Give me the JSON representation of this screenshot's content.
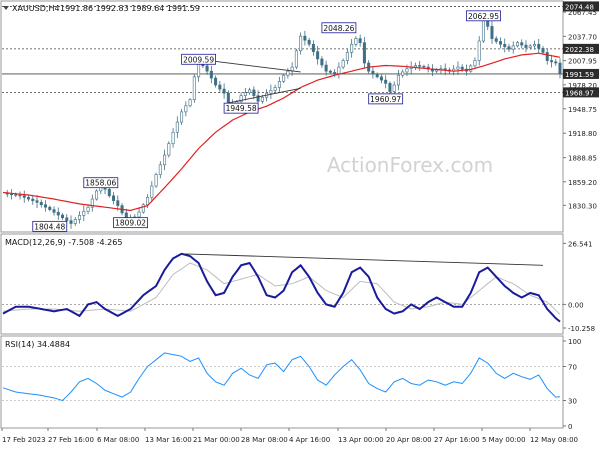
{
  "header": {
    "symbol": "XAUUSD,H4",
    "ohlc": "1991.86 1992.83 1989.64 1991.59"
  },
  "watermark": "ActionForex.com",
  "colors": {
    "candle": "#3f6f85",
    "ma": "#e02020",
    "macd": "#1a1a9c",
    "signal": "#bdbdbd",
    "rsi": "#1e90ff",
    "trendline": "#333333",
    "label_border": "#1a1a9c",
    "price_tag_bg": "#2b2b2b",
    "price_tag_fg": "#ffffff"
  },
  "chart_data": [
    {
      "type": "candlestick",
      "panel": "price",
      "ylim": [
        1800,
        2075
      ],
      "y_ticks": [
        "2067.45",
        "2037.70",
        "2007.95",
        "1978.20",
        "1948.75",
        "1918.80",
        "1888.85",
        "1859.20",
        "1830.30"
      ],
      "x_ticks": [
        "17 Feb 2023",
        "27 Feb 16:00",
        "6 Mar 08:00",
        "13 Mar 16:00",
        "21 Mar 00:00",
        "28 Mar 08:00",
        "4 Apr 16:00",
        "13 Apr 00:00",
        "20 Apr 08:00",
        "27 Apr 16:00",
        "5 May 00:00",
        "12 May 08:00"
      ],
      "close_path": [
        [
          0,
          1845
        ],
        [
          4,
          1842
        ],
        [
          8,
          1834
        ],
        [
          11,
          1825
        ],
        [
          14,
          1815
        ],
        [
          16,
          1808
        ],
        [
          18,
          1818
        ],
        [
          20,
          1828
        ],
        [
          22,
          1848
        ],
        [
          23,
          1858
        ],
        [
          25,
          1842
        ],
        [
          27,
          1830
        ],
        [
          29,
          1812
        ],
        [
          30,
          1810
        ],
        [
          32,
          1822
        ],
        [
          34,
          1840
        ],
        [
          36,
          1868
        ],
        [
          38,
          1892
        ],
        [
          40,
          1920
        ],
        [
          42,
          1945
        ],
        [
          44,
          1960
        ],
        [
          45,
          1988
        ],
        [
          46,
          2008
        ],
        [
          48,
          1995
        ],
        [
          50,
          1978
        ],
        [
          52,
          1968
        ],
        [
          53,
          1955
        ],
        [
          54,
          1950
        ],
        [
          56,
          1965
        ],
        [
          58,
          1972
        ],
        [
          60,
          1958
        ],
        [
          62,
          1968
        ],
        [
          64,
          1975
        ],
        [
          66,
          1990
        ],
        [
          68,
          2000
        ],
        [
          69,
          2020
        ],
        [
          70,
          2038
        ],
        [
          72,
          2028
        ],
        [
          74,
          2010
        ],
        [
          76,
          1995
        ],
        [
          78,
          1992
        ],
        [
          80,
          2008
        ],
        [
          82,
          2028
        ],
        [
          83,
          2035
        ],
        [
          84,
          2030
        ],
        [
          85,
          2005
        ],
        [
          86,
          1995
        ],
        [
          88,
          1988
        ],
        [
          90,
          1980
        ],
        [
          91,
          1970
        ],
        [
          92,
          1978
        ],
        [
          93,
          1990
        ],
        [
          95,
          1998
        ],
        [
          97,
          2002
        ],
        [
          99,
          2000
        ],
        [
          101,
          1995
        ],
        [
          103,
          1998
        ],
        [
          105,
          1995
        ],
        [
          107,
          2000
        ],
        [
          109,
          1995
        ],
        [
          111,
          2008
        ],
        [
          112,
          2032
        ],
        [
          113,
          2060
        ],
        [
          114,
          2050
        ],
        [
          115,
          2035
        ],
        [
          117,
          2028
        ],
        [
          119,
          2022
        ],
        [
          121,
          2030
        ],
        [
          123,
          2024
        ],
        [
          125,
          2028
        ],
        [
          127,
          2018
        ],
        [
          128,
          2008
        ],
        [
          130,
          2005
        ],
        [
          131,
          1991.59
        ]
      ],
      "ma_path": [
        [
          0,
          1846
        ],
        [
          6,
          1843
        ],
        [
          12,
          1838
        ],
        [
          18,
          1832
        ],
        [
          24,
          1828
        ],
        [
          30,
          1824
        ],
        [
          34,
          1830
        ],
        [
          38,
          1852
        ],
        [
          42,
          1875
        ],
        [
          46,
          1900
        ],
        [
          50,
          1920
        ],
        [
          54,
          1935
        ],
        [
          58,
          1945
        ],
        [
          62,
          1952
        ],
        [
          66,
          1962
        ],
        [
          70,
          1975
        ],
        [
          74,
          1984
        ],
        [
          78,
          1990
        ],
        [
          82,
          1995
        ],
        [
          86,
          2000
        ],
        [
          90,
          2002
        ],
        [
          94,
          2001
        ],
        [
          98,
          1999
        ],
        [
          102,
          1997
        ],
        [
          106,
          1995
        ],
        [
          110,
          1997
        ],
        [
          114,
          2003
        ],
        [
          118,
          2010
        ],
        [
          122,
          2015
        ],
        [
          126,
          2017
        ],
        [
          128,
          2015
        ],
        [
          131,
          2012
        ]
      ],
      "trendlines": [
        [
          [
            46,
            2009.59
          ],
          [
            70,
            1994
          ]
        ],
        [
          [
            53,
            1956
          ],
          [
            70,
            1974
          ]
        ]
      ],
      "labels": [
        {
          "text": "1804.48",
          "x": 11,
          "y": 1804.48
        },
        {
          "text": "1858.06",
          "x": 23,
          "y": 1858.06
        },
        {
          "text": "1809.02",
          "x": 30,
          "y": 1809.02
        },
        {
          "text": "2009.59",
          "x": 46,
          "y": 2009.59
        },
        {
          "text": "1949.58",
          "x": 56,
          "y": 1949.58
        },
        {
          "text": "2048.26",
          "x": 79,
          "y": 2048.26
        },
        {
          "text": "1960.97",
          "x": 90,
          "y": 1960.97
        },
        {
          "text": "2062.95",
          "x": 113,
          "y": 2062.95
        }
      ],
      "hlines": [
        {
          "value": 2074.48,
          "label": "2074.48",
          "style": "dashed"
        },
        {
          "value": 2022.38,
          "label": "2022.38",
          "style": "dashed"
        },
        {
          "value": 1991.59,
          "label": "1991.59",
          "style": "solid",
          "current": true
        },
        {
          "value": 1968.97,
          "label": "1968.97",
          "style": "dashed"
        }
      ]
    },
    {
      "type": "line",
      "panel": "macd",
      "title": "MACD(12,26,9) -7.508 -4.265",
      "ylim": [
        -12,
        28
      ],
      "y_ticks": [
        "26.541",
        "0.00",
        "-10.258"
      ],
      "series": [
        {
          "name": "MACD",
          "values": [
            [
              0,
              -4
            ],
            [
              3,
              -1
            ],
            [
              6,
              -1
            ],
            [
              9,
              -2
            ],
            [
              12,
              -3
            ],
            [
              15,
              -2
            ],
            [
              18,
              -5
            ],
            [
              20,
              0
            ],
            [
              22,
              1
            ],
            [
              24,
              -2
            ],
            [
              27,
              -5
            ],
            [
              30,
              -2
            ],
            [
              33,
              4
            ],
            [
              36,
              8
            ],
            [
              38,
              15
            ],
            [
              40,
              20
            ],
            [
              42,
              22
            ],
            [
              44,
              21
            ],
            [
              46,
              18
            ],
            [
              48,
              10
            ],
            [
              50,
              4
            ],
            [
              52,
              5
            ],
            [
              54,
              12
            ],
            [
              56,
              17
            ],
            [
              58,
              18
            ],
            [
              60,
              12
            ],
            [
              62,
              4
            ],
            [
              64,
              3
            ],
            [
              66,
              6
            ],
            [
              68,
              14
            ],
            [
              70,
              17
            ],
            [
              72,
              12
            ],
            [
              74,
              5
            ],
            [
              76,
              0
            ],
            [
              78,
              -1
            ],
            [
              80,
              5
            ],
            [
              82,
              14
            ],
            [
              84,
              16
            ],
            [
              86,
              12
            ],
            [
              88,
              3
            ],
            [
              90,
              -2
            ],
            [
              92,
              -4
            ],
            [
              94,
              -3
            ],
            [
              96,
              0
            ],
            [
              98,
              -2
            ],
            [
              100,
              1
            ],
            [
              102,
              3
            ],
            [
              104,
              1
            ],
            [
              106,
              -1
            ],
            [
              108,
              -1
            ],
            [
              110,
              5
            ],
            [
              112,
              14
            ],
            [
              114,
              16
            ],
            [
              116,
              12
            ],
            [
              118,
              8
            ],
            [
              120,
              5
            ],
            [
              122,
              3
            ],
            [
              124,
              5
            ],
            [
              126,
              4
            ],
            [
              128,
              -2
            ],
            [
              130,
              -6
            ],
            [
              131,
              -7.5
            ]
          ]
        },
        {
          "name": "Signal",
          "values": [
            [
              0,
              -3
            ],
            [
              6,
              -2
            ],
            [
              12,
              -2
            ],
            [
              18,
              -3
            ],
            [
              24,
              -2
            ],
            [
              30,
              -3
            ],
            [
              36,
              3
            ],
            [
              40,
              13
            ],
            [
              44,
              18
            ],
            [
              48,
              15
            ],
            [
              52,
              9
            ],
            [
              56,
              11
            ],
            [
              60,
              13
            ],
            [
              64,
              8
            ],
            [
              68,
              9
            ],
            [
              72,
              12
            ],
            [
              76,
              6
            ],
            [
              80,
              3
            ],
            [
              84,
              10
            ],
            [
              88,
              9
            ],
            [
              92,
              1
            ],
            [
              96,
              -2
            ],
            [
              100,
              -1
            ],
            [
              104,
              1
            ],
            [
              108,
              0
            ],
            [
              112,
              6
            ],
            [
              116,
              12
            ],
            [
              120,
              9
            ],
            [
              124,
              4
            ],
            [
              128,
              1
            ],
            [
              131,
              -4.3
            ]
          ]
        }
      ],
      "trendlines": [
        [
          [
            42,
            22
          ],
          [
            127,
            17
          ]
        ]
      ]
    },
    {
      "type": "line",
      "panel": "rsi",
      "title": "RSI(14) 34.4884",
      "ylim": [
        0,
        100
      ],
      "y_ticks": [
        "100",
        "70",
        "30",
        "0"
      ],
      "series": [
        {
          "name": "RSI",
          "values": [
            [
              0,
              45
            ],
            [
              3,
              40
            ],
            [
              6,
              38
            ],
            [
              9,
              36
            ],
            [
              12,
              33
            ],
            [
              14,
              30
            ],
            [
              16,
              40
            ],
            [
              18,
              52
            ],
            [
              20,
              56
            ],
            [
              22,
              50
            ],
            [
              24,
              42
            ],
            [
              26,
              38
            ],
            [
              28,
              34
            ],
            [
              30,
              40
            ],
            [
              32,
              56
            ],
            [
              34,
              70
            ],
            [
              36,
              78
            ],
            [
              38,
              86
            ],
            [
              40,
              84
            ],
            [
              42,
              82
            ],
            [
              44,
              76
            ],
            [
              46,
              80
            ],
            [
              48,
              62
            ],
            [
              50,
              52
            ],
            [
              52,
              48
            ],
            [
              54,
              62
            ],
            [
              56,
              68
            ],
            [
              58,
              60
            ],
            [
              60,
              56
            ],
            [
              62,
              72
            ],
            [
              64,
              74
            ],
            [
              66,
              64
            ],
            [
              68,
              78
            ],
            [
              70,
              82
            ],
            [
              72,
              70
            ],
            [
              74,
              54
            ],
            [
              76,
              48
            ],
            [
              78,
              60
            ],
            [
              80,
              70
            ],
            [
              82,
              78
            ],
            [
              84,
              66
            ],
            [
              86,
              50
            ],
            [
              88,
              44
            ],
            [
              90,
              40
            ],
            [
              92,
              52
            ],
            [
              94,
              56
            ],
            [
              96,
              50
            ],
            [
              98,
              48
            ],
            [
              100,
              54
            ],
            [
              102,
              52
            ],
            [
              104,
              48
            ],
            [
              106,
              52
            ],
            [
              108,
              50
            ],
            [
              110,
              62
            ],
            [
              112,
              80
            ],
            [
              114,
              74
            ],
            [
              116,
              62
            ],
            [
              118,
              56
            ],
            [
              120,
              62
            ],
            [
              122,
              58
            ],
            [
              124,
              55
            ],
            [
              126,
              60
            ],
            [
              128,
              44
            ],
            [
              130,
              34
            ],
            [
              131,
              34.49
            ]
          ]
        }
      ]
    }
  ]
}
